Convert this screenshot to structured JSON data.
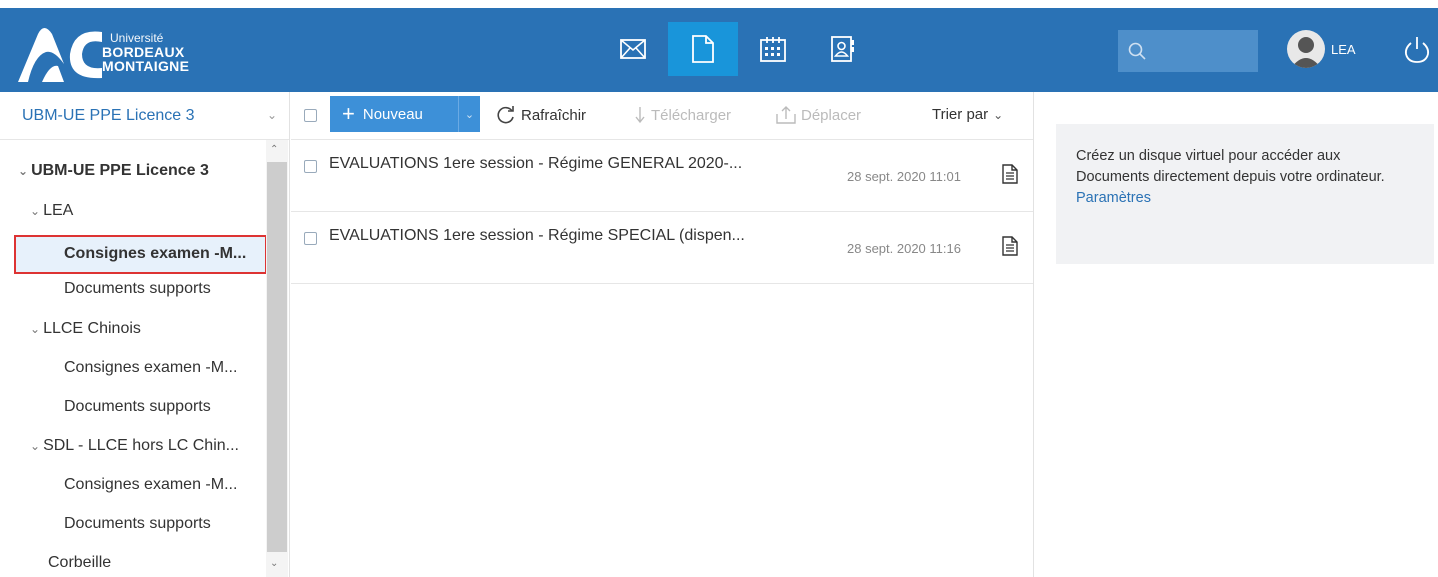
{
  "header": {
    "logo": {
      "line1": "Université",
      "line2": "BORDEAUX",
      "line3": "MONTAIGNE"
    },
    "apps": [
      {
        "icon": "mail-icon",
        "active": false
      },
      {
        "icon": "document-icon",
        "active": true
      },
      {
        "icon": "calendar-icon",
        "active": false
      },
      {
        "icon": "contacts-icon",
        "active": false
      }
    ],
    "search": {
      "icon": "search-icon",
      "value": ""
    },
    "user": {
      "name": "LEA"
    },
    "colors": {
      "bar": "#2a72b5",
      "active_app": "#1995da"
    }
  },
  "sidebar": {
    "drive": "UBM-UE PPE Licence 3",
    "tree": [
      {
        "label": "UBM-UE PPE Licence 3",
        "expanded": true,
        "bold": true
      },
      {
        "label": "LEA",
        "expanded": true
      },
      {
        "label": "Consignes examen -M...",
        "selected": true
      },
      {
        "label": "Documents supports"
      },
      {
        "label": "LLCE Chinois",
        "expanded": true
      },
      {
        "label": "Consignes examen -M..."
      },
      {
        "label": "Documents supports"
      },
      {
        "label": "SDL - LLCE hors LC Chin...",
        "expanded": true
      },
      {
        "label": "Consignes examen -M..."
      },
      {
        "label": "Documents supports"
      },
      {
        "label": "Corbeille"
      }
    ]
  },
  "toolbar": {
    "new_label": "Nouveau",
    "refresh_label": "Rafraîchir",
    "download_label": "Télécharger",
    "move_label": "Déplacer",
    "sort_label": "Trier par"
  },
  "files": [
    {
      "name": "EVALUATIONS 1ere session - Régime GENERAL 2020-...",
      "date": "28 sept. 2020 11:01"
    },
    {
      "name": "EVALUATIONS 1ere session - Régime SPECIAL (dispen...",
      "date": "28 sept. 2020 11:16"
    }
  ],
  "info_panel": {
    "text": "Créez un disque virtuel pour accéder aux Documents directement depuis votre ordinateur.",
    "link": "Paramètres"
  }
}
